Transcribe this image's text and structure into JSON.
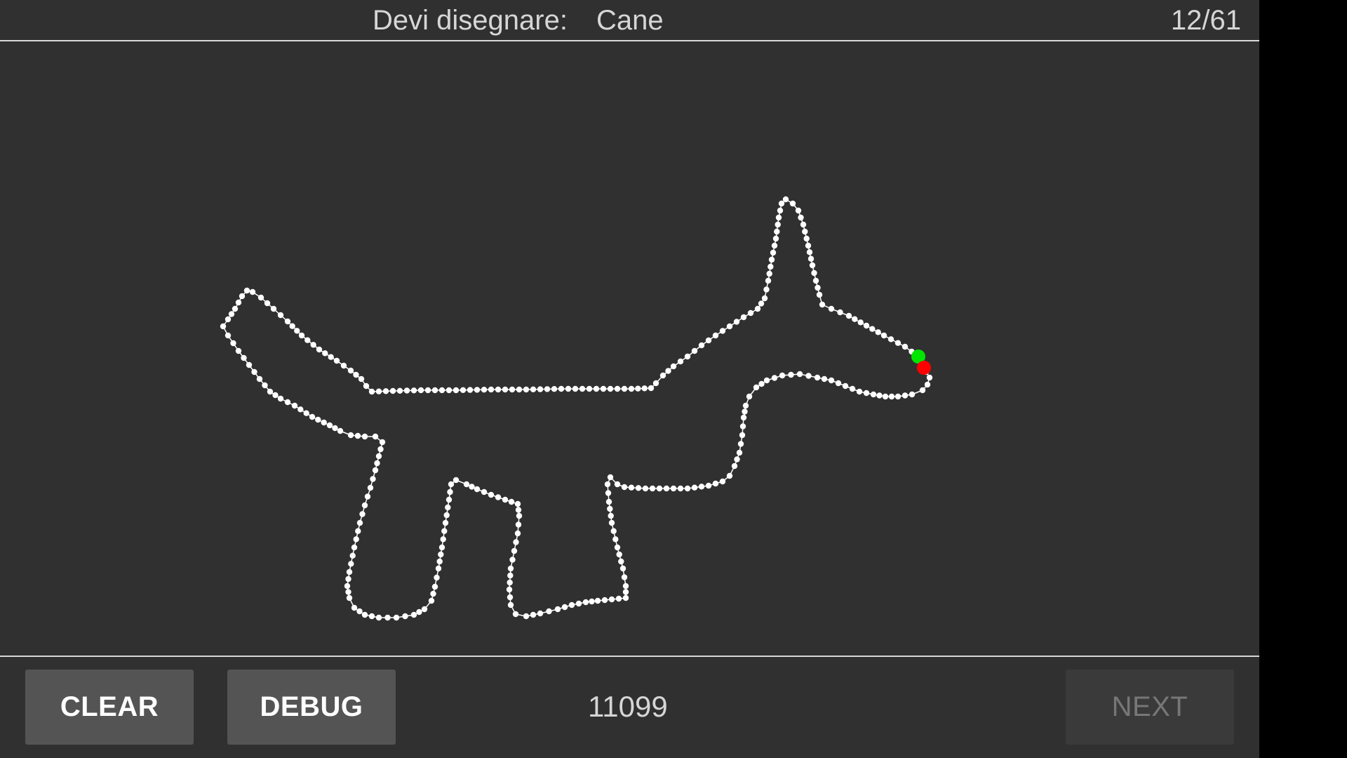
{
  "header": {
    "prompt_label": "Devi disegnare:",
    "prompt_word": "Cane",
    "counter": "12/61"
  },
  "canvas": {
    "stroke_color": "#ffffff",
    "start_marker_color": "#00e600",
    "end_marker_color": "#ff0000"
  },
  "footer": {
    "clear_label": "CLEAR",
    "debug_label": "DEBUG",
    "score": "11099",
    "next_label": "NEXT"
  }
}
